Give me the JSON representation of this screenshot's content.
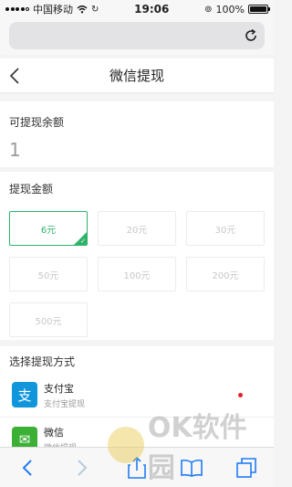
{
  "status_bar": {
    "carrier": "中国移动",
    "time": "19:06",
    "battery": "100%",
    "battery_level": 1.0
  },
  "header": {
    "title": "微信提现",
    "back_icon": "chevron-left-icon"
  },
  "balance": {
    "label": "可提现余额",
    "value": "1"
  },
  "amount": {
    "label": "提现金额",
    "options": [
      "6元",
      "20元",
      "30元",
      "50元",
      "100元",
      "200元",
      "500元"
    ],
    "selected_index": 0
  },
  "method": {
    "label": "选择提现方式",
    "items": [
      {
        "name": "支付宝",
        "desc": "支付宝提现",
        "icon": "alipay-icon",
        "icon_char": "支"
      },
      {
        "name": "微信",
        "desc": "微信提现",
        "icon": "wechat-icon",
        "icon_char": "✉"
      }
    ]
  },
  "watermark": {
    "text": "OK软件园"
  },
  "colors": {
    "accent": "#2fb36a",
    "alipay": "#1296db",
    "wechat": "#3cb035",
    "radio": "#e0202a"
  }
}
